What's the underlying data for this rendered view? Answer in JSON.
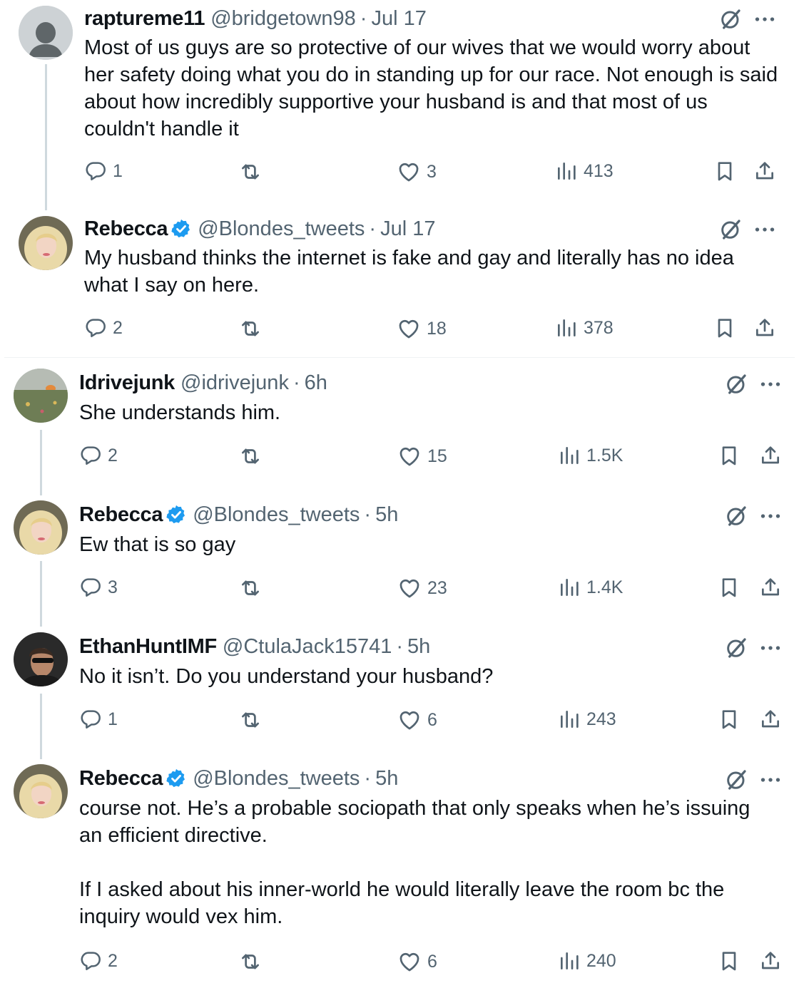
{
  "tweets": [
    {
      "name": "raptureme11",
      "handle": "@bridgetown98",
      "time": "Jul 17",
      "verified": false,
      "text": "Most of us guys are so protective of our wives that we would worry about her safety doing what you do in standing up for our race. Not enough is said about how incredibly supportive your husband is and that most of us couldn't handle it",
      "replies": "1",
      "reposts": "",
      "likes": "3",
      "views": "413"
    },
    {
      "name": "Rebecca",
      "handle": "@Blondes_tweets",
      "time": "Jul 17",
      "verified": true,
      "text": "My husband thinks the internet is fake and gay and literally has no idea what I say on here.",
      "replies": "2",
      "reposts": "",
      "likes": "18",
      "views": "378"
    },
    {
      "name": "Idrivejunk",
      "handle": "@idrivejunk",
      "time": "6h",
      "verified": false,
      "text": "She understands him.",
      "replies": "2",
      "reposts": "",
      "likes": "15",
      "views": "1.5K"
    },
    {
      "name": "Rebecca",
      "handle": "@Blondes_tweets",
      "time": "5h",
      "verified": true,
      "text": "Ew that is so gay",
      "replies": "3",
      "reposts": "",
      "likes": "23",
      "views": "1.4K"
    },
    {
      "name": "EthanHuntIMF",
      "handle": "@CtulaJack15741",
      "time": "5h",
      "verified": false,
      "text": "No it isn’t. Do you understand your husband?",
      "replies": "1",
      "reposts": "",
      "likes": "6",
      "views": "243"
    },
    {
      "name": "Rebecca",
      "handle": "@Blondes_tweets",
      "time": "5h",
      "verified": true,
      "text": "course not. He’s a probable sociopath that only speaks when he’s issuing an efficient directive.\n\nIf I asked about his inner-world he would literally leave the room bc the inquiry would vex him.",
      "replies": "2",
      "reposts": "",
      "likes": "6",
      "views": "240"
    }
  ],
  "colors": {
    "text": "#0f1419",
    "secondary": "#536471",
    "verified": "#1d9bf0",
    "thread_line": "#cfd9de",
    "divider": "#eff3f4"
  },
  "icons": [
    "grok-icon",
    "more-icon",
    "reply-icon",
    "repost-icon",
    "like-icon",
    "views-icon",
    "bookmark-icon",
    "share-icon",
    "verified-badge-icon"
  ]
}
